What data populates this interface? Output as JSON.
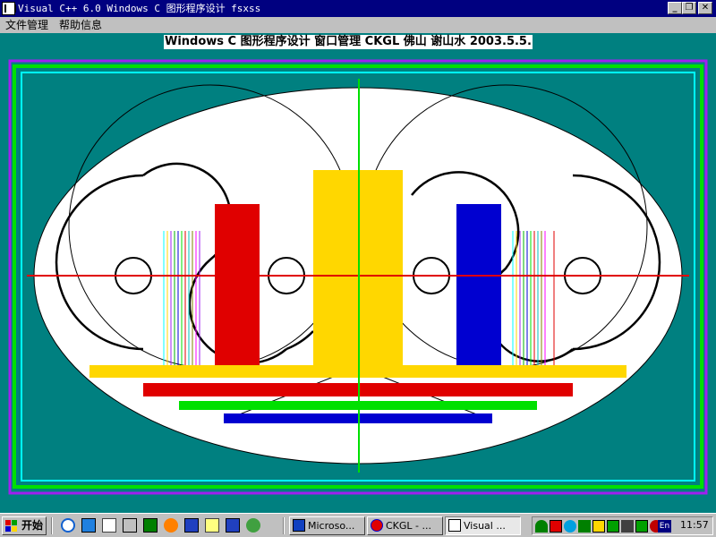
{
  "window": {
    "title": "Visual C++ 6.0 Windows C 图形程序设计 fsxss",
    "minimize_glyph": "_",
    "restore_glyph": "❐",
    "close_glyph": "✕"
  },
  "menu": [
    "文件管理",
    "帮助信息"
  ],
  "canvas": {
    "caption": "Windows C 图形程序设计 窗口管理 CKGL 佛山 谢山水 2003.5.5."
  },
  "colors": {
    "background": "#008080",
    "yellow": "#FFD700",
    "red": "#E00000",
    "blue": "#0000D0",
    "green": "#00E000",
    "purple": "#A020F0",
    "cyan": "#00FFFF"
  },
  "taskbar": {
    "start_label": "开始",
    "quick_launch": [
      "ie-icon",
      "desktop-icon",
      "pen-icon",
      "window-icon",
      "screen-icon",
      "firefox-icon",
      "word-icon",
      "magnifier-icon",
      "cycle-icon",
      "recycle-icon"
    ],
    "tasks": [
      {
        "label": "Microso...",
        "icon": "app-blue-icon"
      },
      {
        "label": "CKGL - ...",
        "icon": "app-color-icon"
      },
      {
        "label": "Visual ...",
        "icon": "app-vc-icon"
      }
    ],
    "tray_icons": [
      "umbrella-icon",
      "network-icon",
      "palette-icon",
      "shield-icon",
      "volume-icon",
      "monitor-icon",
      "speaker-icon",
      "printer-icon",
      "settings-icon",
      "language-icon"
    ],
    "language": "En",
    "clock": "11:57"
  }
}
